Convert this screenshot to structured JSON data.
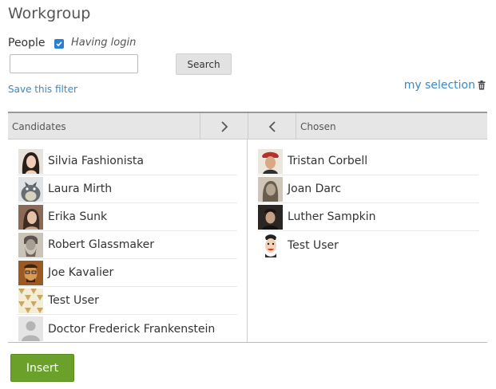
{
  "title": "Workgroup",
  "filter": {
    "people_label": "People",
    "having_login_label": "Having login",
    "having_login_checked": true,
    "search_value": "",
    "search_placeholder": "",
    "search_button": "Search",
    "save_filter": "Save this filter",
    "my_selection": "my selection"
  },
  "panel": {
    "candidates_label": "Candidates",
    "chosen_label": "Chosen",
    "candidates": [
      {
        "name": "Silvia Fashionista",
        "avatar": "woman-dark-hair-portrait"
      },
      {
        "name": "Laura Mirth",
        "avatar": "totoro-character"
      },
      {
        "name": "Erika Sunk",
        "avatar": "woman-painting-portrait"
      },
      {
        "name": "Robert Glassmaker",
        "avatar": "leonardo-sketch-portrait"
      },
      {
        "name": "Joe Kavalier",
        "avatar": "man-with-glasses-photo"
      },
      {
        "name": "Test User",
        "avatar": "gold-pattern"
      },
      {
        "name": "Doctor Frederick Frankenstein",
        "avatar": "default-silhouette"
      }
    ],
    "chosen": [
      {
        "name": "Tristan Corbell",
        "avatar": "man-red-hat-portrait"
      },
      {
        "name": "Joan Darc",
        "avatar": "woman-sketch-portrait"
      },
      {
        "name": "Luther Sampkin",
        "avatar": "man-dark-portrait"
      },
      {
        "name": "Test User",
        "avatar": "cartoon-face"
      }
    ]
  },
  "insert_button": "Insert",
  "colors": {
    "accent_link": "#3a89c9",
    "insert_green": "#6ba12a",
    "checkbox_blue": "#2a7fd4",
    "header_bg": "#e6e6e6"
  }
}
